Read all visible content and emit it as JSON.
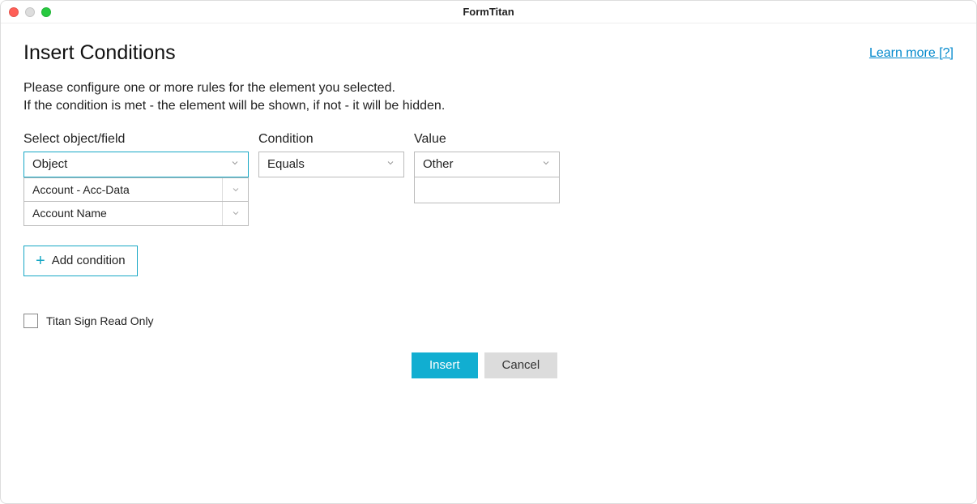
{
  "window": {
    "title": "FormTitan"
  },
  "header": {
    "title": "Insert Conditions",
    "learn_more": "Learn more [?]"
  },
  "description": {
    "line1": "Please configure one or more rules for the element you selected.",
    "line2": "If the condition is met - the element will be shown, if not - it will be hidden."
  },
  "form": {
    "object_label": "Select object/field",
    "condition_label": "Condition",
    "value_label": "Value",
    "object_type_value": "Object",
    "object_account_value": "Account - Acc-Data",
    "object_field_value": "Account Name",
    "condition_value": "Equals",
    "value_value": "Other",
    "value_input": ""
  },
  "add_condition_label": "Add condition",
  "checkbox": {
    "label": "Titan Sign Read Only"
  },
  "buttons": {
    "insert": "Insert",
    "cancel": "Cancel"
  }
}
